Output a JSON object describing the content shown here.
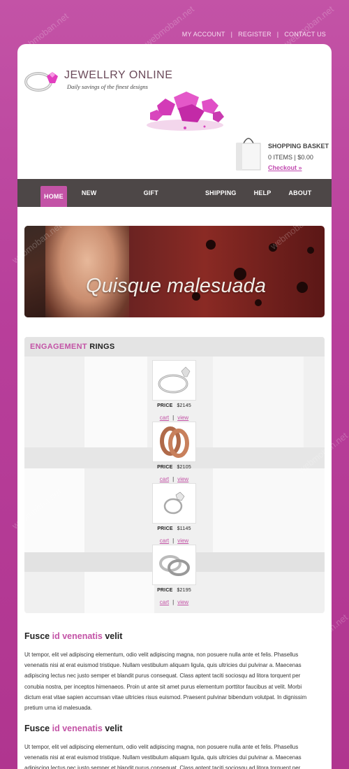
{
  "toplinks": {
    "account": "MY ACCOUNT",
    "register": "REGISTER",
    "contact": "CONTACT US",
    "separator": "|"
  },
  "header": {
    "title": "JEWELLRY ONLINE",
    "tagline": "Daily savings of the finest designs"
  },
  "basket": {
    "title": "SHOPPING BASKET",
    "items": "0 ITEMS | $0.00",
    "checkout": "Checkout »"
  },
  "nav": {
    "items": [
      {
        "label": "HOME",
        "active": true
      },
      {
        "label": "NEW PRODUCTS"
      },
      {
        "label": "GIFT PACKAGES"
      },
      {
        "label": "SHIPPING"
      },
      {
        "label": "HELP"
      },
      {
        "label": "ABOUT US"
      }
    ]
  },
  "banner": {
    "caption": "Quisque malesuada"
  },
  "products": {
    "title_highlight": "ENGAGEMENT",
    "title_rest": "RINGS",
    "price_label": "PRICE",
    "cart_label": "cart",
    "view_label": "view",
    "separator": "|",
    "items": [
      {
        "price": "$2145",
        "icon": "solitaire-ring-icon"
      },
      {
        "price": "$2105",
        "icon": "gold-bands-icon"
      },
      {
        "price": "$1145",
        "icon": "diamond-ring-icon"
      },
      {
        "price": "$2195",
        "icon": "wedding-bands-icon"
      }
    ]
  },
  "articles": [
    {
      "title_start": "Fusce",
      "title_highlight": "id venenatis",
      "title_end": "velit",
      "body": "Ut tempor, elit vel adipiscing elementum, odio velit adipiscing magna, non posuere nulla ante et felis. Phasellus venenatis nisi at erat euismod tristique. Nullam vestibulum aliquam ligula, quis ultricies dui pulvinar a. Maecenas adipiscing lectus nec justo semper et blandit purus consequat. Class aptent taciti sociosqu ad litora torquent per conubia nostra, per inceptos himenaeos. Proin ut ante sit amet purus elementum porttitor faucibus at velit. Morbi dictum erat vitae sapien accumsan vitae ultricies risus euismod. Praesent pulvinar bibendum volutpat. In dignissim pretium urna id malesuada."
    },
    {
      "title_start": "Fusce",
      "title_highlight": "id venenatis",
      "title_end": "velit",
      "body": "Ut tempor, elit vel adipiscing elementum, odio velit adipiscing magna, non posuere nulla ante et felis. Phasellus venenatis nisi at erat euismod tristique. Nullam vestibulum aliquam ligula, quis ultricies dui pulvinar a. Maecenas adipiscing lectus nec justo semper et blandit purus consequat. Class aptent taciti sociosqu ad litora torquent per"
    }
  ],
  "watermark": "webmoban.net",
  "colors": {
    "accent": "#c353a6",
    "nav_bg": "#4d4747",
    "page_bg": "#b83f9b"
  }
}
